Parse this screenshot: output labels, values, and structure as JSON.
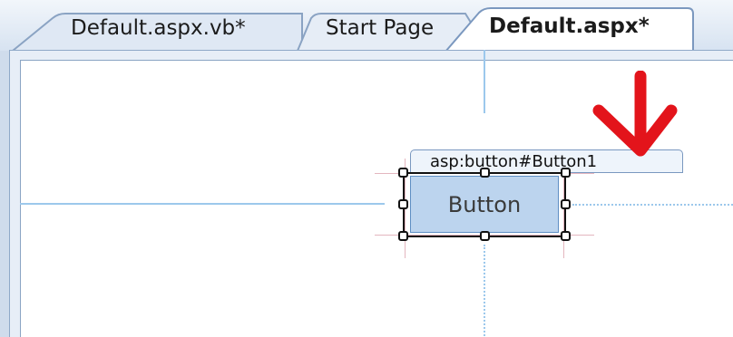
{
  "tabs": [
    {
      "label": "Default.aspx.vb*",
      "active": false
    },
    {
      "label": "Start Page",
      "active": false
    },
    {
      "label": "Default.aspx*",
      "active": true
    }
  ],
  "designer": {
    "tag_label": "asp:button#Button1",
    "button_label": "Button"
  },
  "colors": {
    "tabstrip": "#d7e3f1",
    "canvas": "#ffffff",
    "guide": "#9cc8ec",
    "button_fill": "#bcd4ee",
    "arrow": "#e3141b"
  },
  "icons": [
    "red-arrow-annotation"
  ]
}
